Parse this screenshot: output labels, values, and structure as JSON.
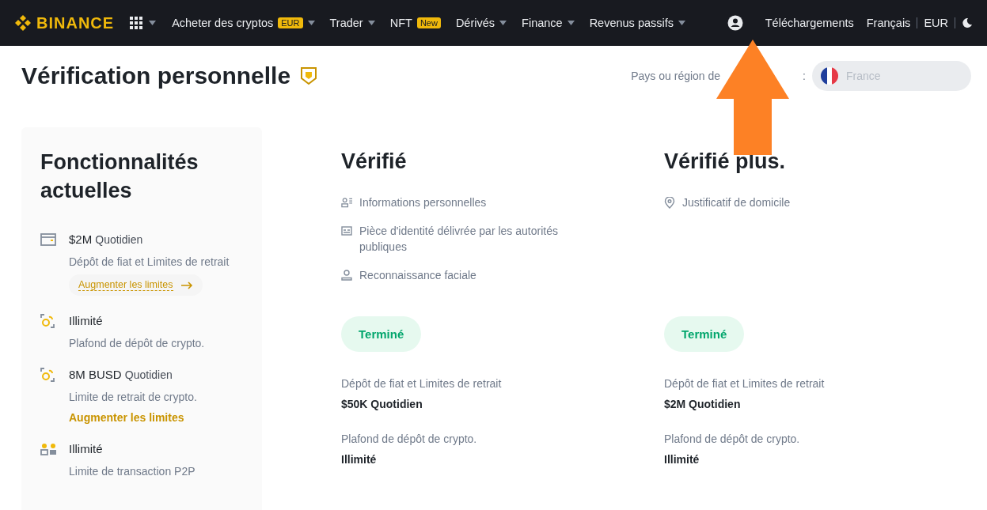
{
  "nav": {
    "logo": "BINANCE",
    "menu": [
      {
        "label": "Acheter des cryptos",
        "badge": "EUR",
        "caret": true
      },
      {
        "label": "Trader",
        "caret": true
      },
      {
        "label": "NFT",
        "badge": "New",
        "caret": false
      },
      {
        "label": "Dérivés",
        "caret": true
      },
      {
        "label": "Finance",
        "caret": true
      },
      {
        "label": "Revenus passifs",
        "caret": true
      }
    ],
    "right": [
      "Téléchargements",
      "Français",
      "EUR"
    ]
  },
  "page": {
    "title": "Vérification personnelle",
    "country_label": "Pays ou région de",
    "country_label_end": ":",
    "country": "France"
  },
  "current": {
    "title": "Fonctionnalités actuelles",
    "features": [
      {
        "kind": "card",
        "value": "$2M",
        "unit": "Quotidien",
        "description": "Dépôt de fiat et Limites de retrait",
        "link": {
          "label": "Augmenter les limites",
          "kind": "pill"
        }
      },
      {
        "kind": "crypto",
        "value": "Illimité",
        "description": "Plafond de dépôt de crypto."
      },
      {
        "kind": "crypto",
        "value": "8M BUSD",
        "unit": "Quotidien",
        "description": "Limite de retrait de crypto.",
        "link": {
          "label": "Augmenter les limites",
          "kind": "plain"
        }
      },
      {
        "kind": "p2p",
        "value": "Illimité",
        "description": "Limite de transaction P2P"
      }
    ]
  },
  "levels": [
    {
      "title": "Vérifié",
      "requirements": [
        {
          "kind": "person-info",
          "text": "Informations personnelles"
        },
        {
          "kind": "id-card",
          "text": "Pièce d'identité délivrée par les autorités publiques"
        },
        {
          "kind": "face",
          "text": "Reconnaissance faciale"
        }
      ],
      "status": "Terminé",
      "limits": [
        {
          "label": "Dépôt de fiat et Limites de retrait",
          "value": "$50K Quotidien"
        },
        {
          "label": "Plafond de dépôt de crypto.",
          "value": "Illimité"
        }
      ]
    },
    {
      "title": "Vérifié plus.",
      "requirements": [
        {
          "kind": "location",
          "text": "Justificatif de domicile"
        }
      ],
      "status": "Terminé",
      "limits": [
        {
          "label": "Dépôt de fiat et Limites de retrait",
          "value": "$2M Quotidien"
        },
        {
          "label": "Plafond de dépôt de crypto.",
          "value": "Illimité"
        }
      ]
    }
  ]
}
